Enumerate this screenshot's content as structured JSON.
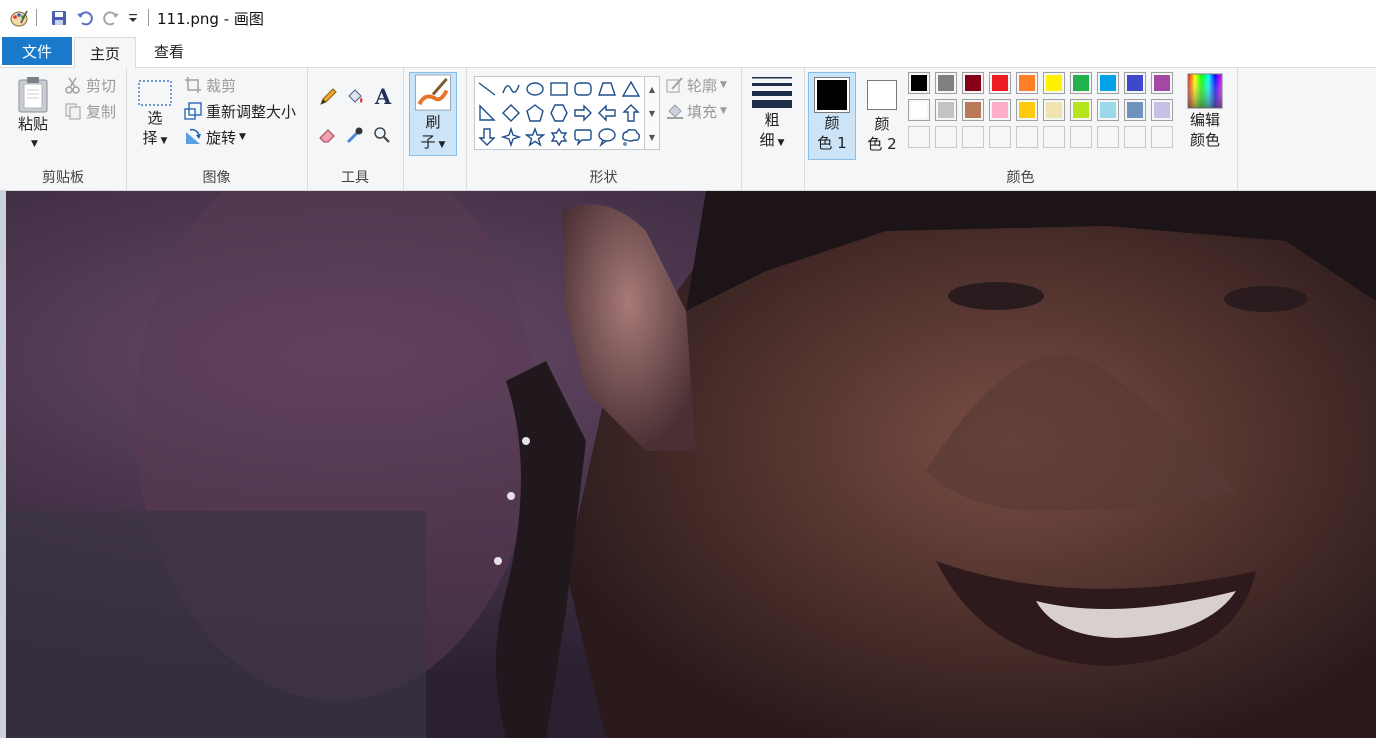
{
  "titlebar": {
    "doc_title": "111.png - 画图",
    "icons": [
      "paint-app-icon",
      "save-icon",
      "undo-icon",
      "redo-icon",
      "customize-qat-icon"
    ]
  },
  "tabs": {
    "file": "文件",
    "home": "主页",
    "view": "查看",
    "active": "主页"
  },
  "ribbon": {
    "clipboard": {
      "label": "剪贴板",
      "paste": "粘贴",
      "cut": "剪切",
      "copy": "复制"
    },
    "image": {
      "label": "图像",
      "select_line1": "选",
      "select_line2": "择",
      "crop": "裁剪",
      "resize": "重新调整大小",
      "rotate": "旋转"
    },
    "tools": {
      "label": "工具",
      "items": [
        "pencil-icon",
        "fill-bucket-icon",
        "text-icon",
        "eraser-icon",
        "color-picker-icon",
        "magnifier-icon"
      ]
    },
    "brushes": {
      "line1": "刷",
      "line2": "子"
    },
    "shapes": {
      "label": "形状",
      "outline": "轮廓",
      "fill": "填充",
      "items": [
        "line",
        "curve",
        "oval",
        "rectangle",
        "rounded-rectangle",
        "polygon",
        "triangle",
        "right-triangle",
        "diamond",
        "pentagon",
        "hexagon",
        "right-arrow",
        "left-arrow",
        "up-arrow",
        "down-arrow",
        "four-point-star",
        "five-point-star",
        "six-point-star",
        "rounded-callout",
        "oval-callout",
        "cloud-callout"
      ]
    },
    "size": {
      "line1": "粗",
      "line2": "细"
    },
    "colors": {
      "label": "颜色",
      "color1_line1": "颜",
      "color1_line2": "色 1",
      "color2_line1": "颜",
      "color2_line2": "色 2",
      "edit_line1": "编辑",
      "edit_line2": "颜色",
      "color1_value": "#000000",
      "color2_value": "#ffffff",
      "palette_row1": [
        "#000000",
        "#7f7f7f",
        "#880015",
        "#ed1c24",
        "#ff7f27",
        "#fff200",
        "#22b14c",
        "#00a2e8",
        "#3f48cc",
        "#a349a4"
      ],
      "palette_row2": [
        "#ffffff",
        "#c3c3c3",
        "#b97a57",
        "#ffaec9",
        "#ffc90e",
        "#efe4b0",
        "#b5e61d",
        "#99d9ea",
        "#7092be",
        "#c8bfe7"
      ],
      "palette_row3": [
        "#ffffff",
        "#ffffff",
        "#ffffff",
        "#ffffff",
        "#ffffff",
        "#ffffff",
        "#ffffff",
        "#ffffff",
        "#ffffff",
        "#ffffff"
      ]
    }
  },
  "canvas": {
    "content": "photo-close-up-smiling-face"
  }
}
